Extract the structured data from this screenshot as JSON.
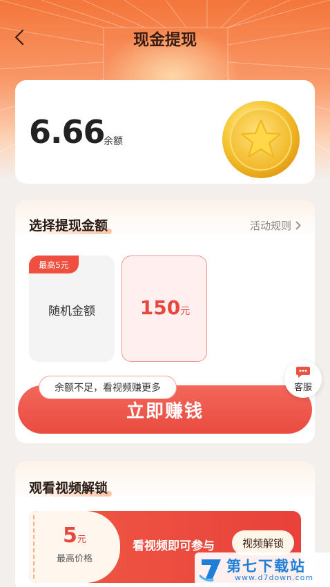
{
  "header": {
    "title": "现金提现"
  },
  "balance": {
    "amount": "6.66",
    "unit": "余额"
  },
  "withdraw": {
    "section_title": "选择提现金额",
    "rules_label": "活动规则",
    "options": [
      {
        "badge": "最高5元",
        "label": "随机金额"
      },
      {
        "value": "150",
        "unit": "元"
      }
    ],
    "tip": "余额不足，看视频赚更多",
    "earn_button": "立即赚钱"
  },
  "customer_service": {
    "label": "客服"
  },
  "unlock": {
    "section_title": "观看视频解锁",
    "ticket_value": "5",
    "ticket_unit": "元",
    "ticket_sub": "最高价格",
    "text": "看视频即可参与",
    "button": "视频解锁"
  },
  "watermark": {
    "title": "第七下载站",
    "url": "www.d7down.com"
  },
  "colors": {
    "accent": "#e94b40",
    "header_bg": "#f4763b",
    "title_text": "#3a1d12",
    "link_gray": "#8a8582"
  }
}
